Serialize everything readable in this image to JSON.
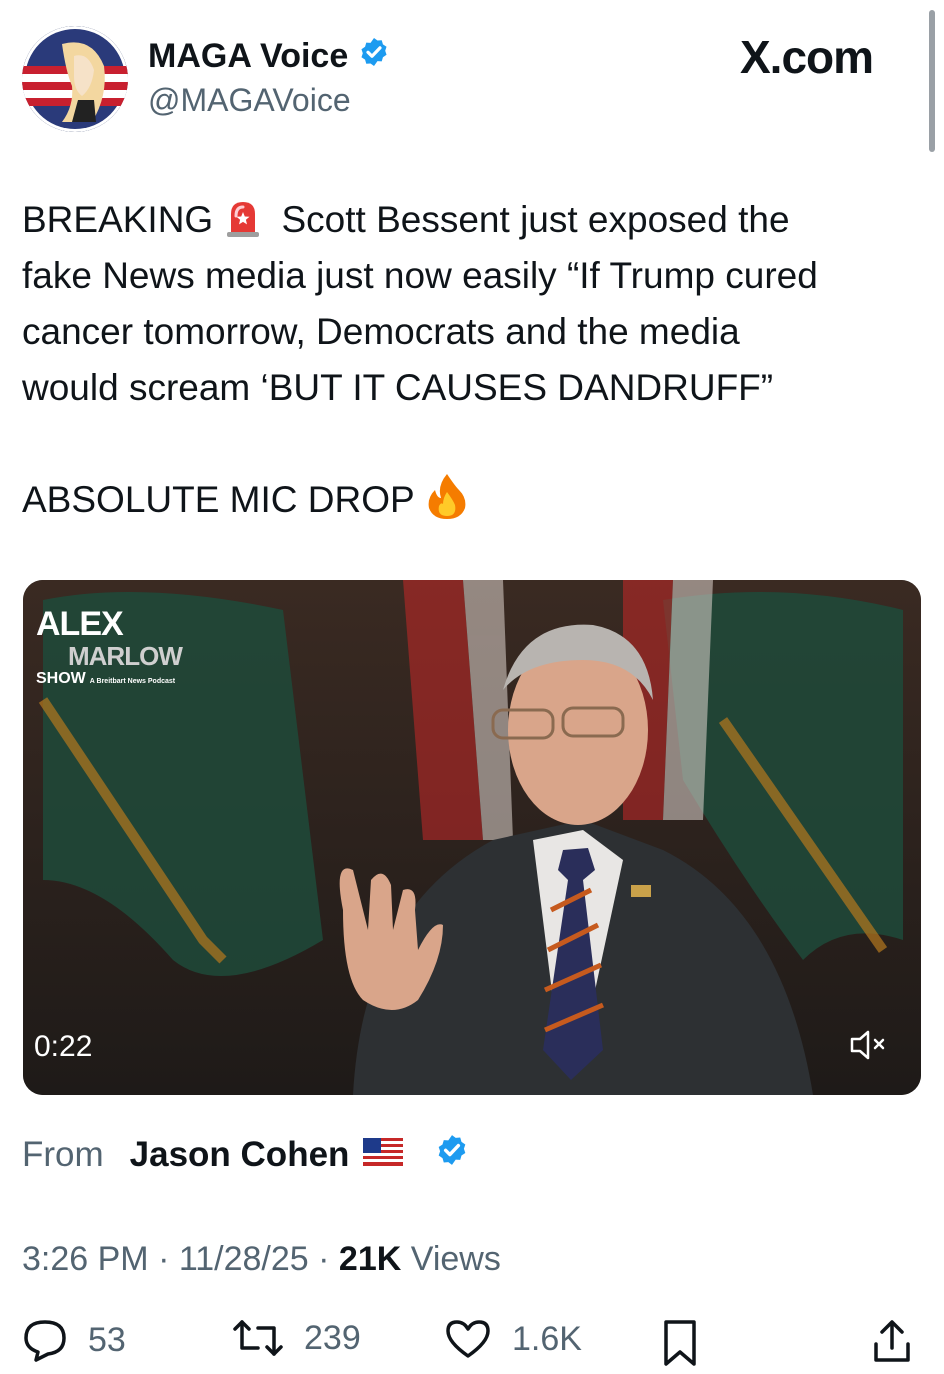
{
  "header": {
    "display_name": "MAGA Voice",
    "handle": "@MAGAVoice",
    "brand": "X.com"
  },
  "tweet": {
    "lines": [
      {
        "before": "BREAKING",
        "emoji": "rotating-light",
        "after": " Scott Bessent just exposed the"
      },
      {
        "text": "fake News media just now easily “If Trump cured"
      },
      {
        "text": "cancer tomorrow, Democrats and the media"
      },
      {
        "text": "would scream ‘BUT IT CAUSES DANDRUFF”"
      }
    ],
    "closing": "ABSOLUTE MIC DROP",
    "closing_emoji": "fire"
  },
  "video": {
    "duration": "0:22",
    "logo_line1": "ALEX",
    "logo_line2": "MARLOW",
    "logo_line3": "SHOW",
    "logo_tagline": "A Breitbart News Podcast",
    "mute_icon": "speaker-muted-icon"
  },
  "source": {
    "label": "From",
    "name": "Jason Cohen",
    "flag": "us-flag"
  },
  "meta": {
    "time": "3:26 PM",
    "date": "11/28/25",
    "views_count": "21K",
    "views_label": "Views",
    "separator": "·"
  },
  "actions": {
    "replies": "53",
    "reposts": "239",
    "likes": "1.6K"
  },
  "colors": {
    "verified": "#1d9bf0",
    "text": "#0f1419",
    "secondary": "#536471"
  }
}
